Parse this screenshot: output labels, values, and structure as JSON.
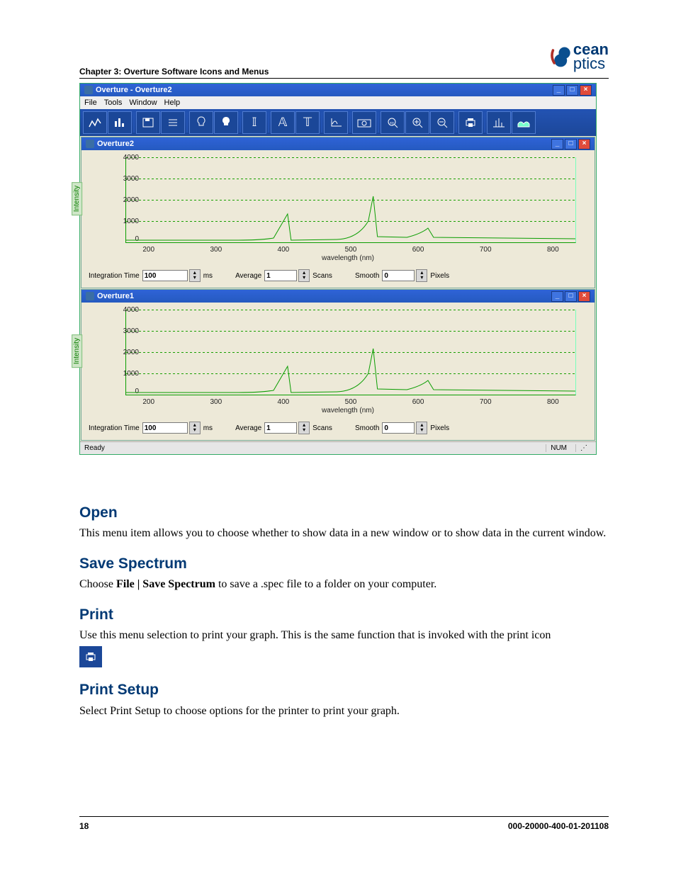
{
  "doc": {
    "chapter_header": "Chapter 3: Overture Software Icons and Menus",
    "page_number": "18",
    "doc_number": "000-20000-400-01-201108",
    "logo_top": "cean",
    "logo_bottom": "ptics"
  },
  "screenshot": {
    "main_title": "Overture - Overture2",
    "menus": {
      "file": "File",
      "tools": "Tools",
      "window": "Window",
      "help": "Help"
    },
    "status_left": "Ready",
    "status_right": "NUM",
    "panel1": {
      "title": "Overture2",
      "yaxis": "Intensity",
      "xaxis": "wavelength (nm)",
      "yticks": {
        "t0": "0",
        "t1": "1000",
        "t2": "2000",
        "t3": "3000",
        "t4": "4000"
      },
      "xticks": {
        "x0": "200",
        "x1": "300",
        "x2": "400",
        "x3": "500",
        "x4": "600",
        "x5": "700",
        "x6": "800"
      },
      "controls": {
        "integration_label": "Integration Time",
        "integration_value": "100",
        "ms": "ms",
        "average_label": "Average",
        "average_value": "1",
        "scans": "Scans",
        "smooth_label": "Smooth",
        "smooth_value": "0",
        "pixels": "Pixels"
      }
    },
    "panel2": {
      "title": "Overture1",
      "yaxis": "Intensity",
      "xaxis": "wavelength (nm)",
      "yticks": {
        "t0": "0",
        "t1": "1000",
        "t2": "2000",
        "t3": "3000",
        "t4": "4000"
      },
      "xticks": {
        "x0": "200",
        "x1": "300",
        "x2": "400",
        "x3": "500",
        "x4": "600",
        "x5": "700",
        "x6": "800"
      },
      "controls": {
        "integration_label": "Integration Time",
        "integration_value": "100",
        "ms": "ms",
        "average_label": "Average",
        "average_value": "1",
        "scans": "Scans",
        "smooth_label": "Smooth",
        "smooth_value": "0",
        "pixels": "Pixels"
      }
    }
  },
  "sections": {
    "open": {
      "title": "Open",
      "body": "This menu item allows you to choose whether to show data in a new window or to show data in the current window."
    },
    "save": {
      "title": "Save Spectrum",
      "body_pre": "Choose ",
      "body_bold": "File | Save Spectrum",
      "body_post": " to save a .spec file to a folder on your computer."
    },
    "print": {
      "title": "Print",
      "body": "Use this menu selection to print your graph. This is the same function that is invoked with the print icon"
    },
    "psetup": {
      "title": "Print Setup",
      "body": "Select Print Setup to choose options for the printer to print your graph."
    }
  }
}
